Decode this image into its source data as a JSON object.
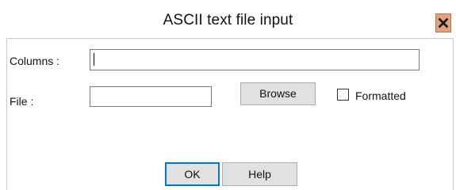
{
  "window": {
    "title": "ASCII text file input",
    "close_icon": "close-x-icon"
  },
  "form": {
    "columns_label": "Columns :",
    "columns_value": "",
    "file_label": "File :",
    "file_value": "",
    "browse_label": "Browse",
    "formatted_label": "Formatted",
    "formatted_checked": false
  },
  "footer": {
    "ok_label": "OK",
    "help_label": "Help"
  },
  "colors": {
    "close_button_bg": "#e2a17f",
    "button_bg": "#e1e1e1",
    "focus_border": "#0078d7"
  }
}
